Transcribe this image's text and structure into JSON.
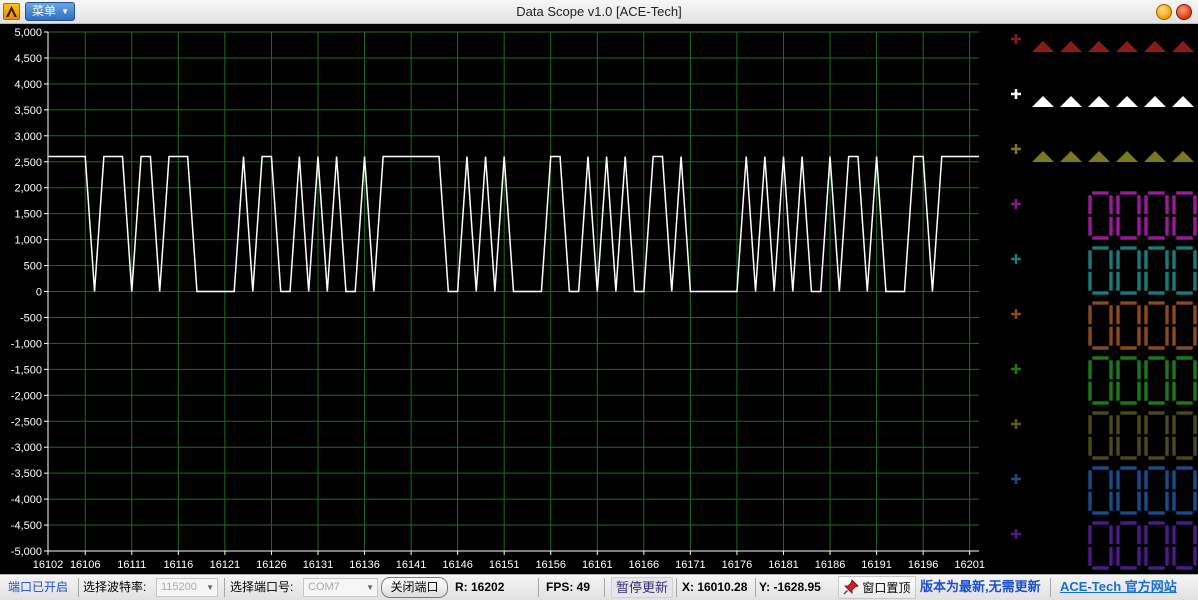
{
  "window": {
    "title": "Data Scope  v1.0    [ACE-Tech]",
    "menu_label": "菜单",
    "icons": [
      "app-logo-icon",
      "minimize-icon",
      "close-icon"
    ]
  },
  "statusbar": {
    "port_status": "端口已开启",
    "baud_label": "选择波特率:",
    "baud_value": "115200",
    "port_label": "选择端口号:",
    "port_value": "COM7",
    "close_port_button": "关闭端口",
    "r_readout": "R:  16202",
    "fps_readout": "FPS:  49",
    "pause_button": "暂停更新",
    "x_readout": "X:  16010.28",
    "y_readout": "Y:  -1628.95",
    "pin_button": "窗口置顶",
    "version_status": "版本为最新,无需更新",
    "website_link": "ACE-Tech 官方网站"
  },
  "channels": {
    "colors": [
      "#8b1a1a",
      "#ffffff",
      "#7a7a1a",
      "#8a1a8a",
      "#1a7a7a",
      "#8a4a1a",
      "#1a7a1a",
      "#5a5a1a",
      "#1a4a8a",
      "#4a1a8a"
    ],
    "triangle_channels": 3,
    "triangles_per_channel": 6,
    "digit_channels": 7,
    "digits_shown": [
      "0",
      "0",
      "0",
      "0"
    ]
  },
  "chart_data": {
    "type": "line",
    "title": "",
    "xlabel": "",
    "ylabel": "",
    "xlim": [
      16102,
      16202
    ],
    "ylim": [
      -5000,
      5000
    ],
    "grid": true,
    "background": "#000000",
    "grid_color": "#1e6b1e",
    "line_color": "#ffffff",
    "x_ticks": [
      16102,
      16106,
      16111,
      16116,
      16121,
      16126,
      16131,
      16136,
      16141,
      16146,
      16151,
      16156,
      16161,
      16166,
      16171,
      16176,
      16181,
      16186,
      16191,
      16196,
      16201
    ],
    "y_ticks": [
      5000,
      4500,
      4000,
      3500,
      3000,
      2500,
      2000,
      1500,
      1000,
      500,
      0,
      -500,
      -1000,
      -1500,
      -2000,
      -2500,
      -3000,
      -3500,
      -4000,
      -4500,
      -5000
    ],
    "y_tick_labels": [
      "5,000",
      "4,500",
      "4,000",
      "3,500",
      "3,000",
      "2,500",
      "2,000",
      "1,500",
      "1,000",
      "500",
      "0",
      "-500",
      "-1,000",
      "-1,500",
      "-2,000",
      "-2,500",
      "-3,000",
      "-3,500",
      "-4,000",
      "-4,500",
      "-5,000"
    ],
    "series": [
      {
        "color": "#ffffff",
        "x": [
          16102,
          16106,
          16107,
          16108,
          16110,
          16111,
          16112,
          16113,
          16114,
          16115,
          16116,
          16117,
          16118,
          16120,
          16121,
          16122,
          16123,
          16124,
          16125,
          16126,
          16127,
          16128,
          16129,
          16130,
          16131,
          16132,
          16133,
          16134,
          16135,
          16136,
          16137,
          16138,
          16139,
          16140,
          16141,
          16142,
          16143,
          16144,
          16145,
          16146,
          16147,
          16148,
          16149,
          16150,
          16151,
          16152,
          16153,
          16154,
          16155,
          16156,
          16157,
          16158,
          16159,
          16160,
          16161,
          16162,
          16163,
          16164,
          16165,
          16166,
          16167,
          16168,
          16169,
          16170,
          16171,
          16172,
          16173,
          16174,
          16175,
          16176,
          16177,
          16178,
          16179,
          16180,
          16181,
          16182,
          16183,
          16184,
          16185,
          16186,
          16187,
          16188,
          16189,
          16190,
          16191,
          16192,
          16193,
          16194,
          16195,
          16196,
          16197,
          16198,
          16199,
          16200,
          16201,
          16202
        ],
        "y": [
          2600,
          2600,
          0,
          2600,
          2600,
          0,
          2600,
          2600,
          0,
          2600,
          2600,
          2600,
          0,
          0,
          0,
          0,
          2600,
          0,
          2600,
          2600,
          0,
          0,
          2600,
          0,
          2600,
          0,
          2600,
          0,
          0,
          2600,
          0,
          2600,
          2600,
          2600,
          2600,
          2600,
          2600,
          2600,
          0,
          0,
          2600,
          0,
          2600,
          0,
          2600,
          0,
          0,
          0,
          0,
          2600,
          2600,
          0,
          0,
          2600,
          0,
          2600,
          0,
          2600,
          0,
          0,
          2600,
          2600,
          0,
          2600,
          0,
          0,
          0,
          0,
          0,
          0,
          2600,
          0,
          2600,
          0,
          2600,
          0,
          2600,
          0,
          0,
          2600,
          0,
          2600,
          2600,
          0,
          2600,
          0,
          0,
          0,
          2600,
          2600,
          0,
          2600,
          2600,
          2600,
          2600,
          2600
        ]
      }
    ]
  }
}
